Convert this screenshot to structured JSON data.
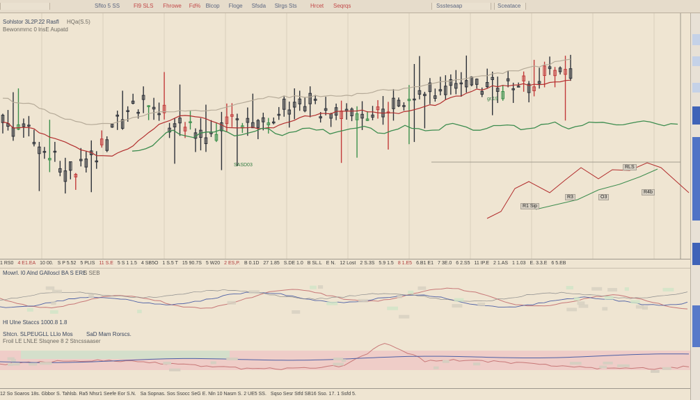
{
  "toolbar": {
    "items": [
      {
        "label": "Sh̃to 5 SS",
        "color": "#5b6680"
      },
      {
        "label": "Fl9 SLS",
        "color": "#c24848"
      },
      {
        "label": "Fhrowe",
        "color": "#c24848"
      },
      {
        "label": "Fd%",
        "color": "#c24848"
      },
      {
        "label": "Blcop",
        "color": "#5b6680"
      },
      {
        "label": "Floge",
        "color": "#5b6680"
      },
      {
        "label": "Sfsda",
        "color": "#5b6680"
      },
      {
        "label": "Slrgs Sts",
        "color": "#5b6680"
      },
      {
        "label": "Hrcet",
        "color": "#c24848"
      },
      {
        "label": "Seqrqs",
        "color": "#c24848"
      }
    ],
    "right_items": [
      {
        "label": "Ssstesaap"
      },
      {
        "label": "Sceatace"
      }
    ]
  },
  "main": {
    "legend_line1": "Sohlstor 3L2P.22 Rasfl",
    "legend_line2": "Bewonmrnc 0 lnsE Aupatd",
    "legend_right": "HQa(S.5)",
    "note_green": "SASD03",
    "note_green2": "gr.19",
    "tags": [
      "R1 Sip",
      "R3",
      "R4b",
      "O3",
      "RLS"
    ]
  },
  "top_axis_labels": [
    {
      "text": "1 RS0",
      "red": false
    },
    {
      "text": "4 E1.EA",
      "red": true
    },
    {
      "text": "10 00.",
      "red": false
    },
    {
      "text": "S P 5.52",
      "red": false
    },
    {
      "text": "5 PLIS",
      "red": false
    },
    {
      "text": "11 S.E",
      "red": true
    },
    {
      "text": "5 S 1 1.5",
      "red": false
    },
    {
      "text": "4 SB5O",
      "red": false
    },
    {
      "text": "1 S.5 T",
      "red": false
    },
    {
      "text": "15 90.7S",
      "red": false
    },
    {
      "text": "5 W20",
      "red": false
    },
    {
      "text": "2 ES,P.",
      "red": true
    },
    {
      "text": "B 0.1D",
      "red": false
    },
    {
      "text": "27 1.85",
      "red": false
    },
    {
      "text": "S.DE 1.0",
      "red": false
    },
    {
      "text": "B SL.L",
      "red": false
    },
    {
      "text": "E N.",
      "red": false
    },
    {
      "text": "12 Lost",
      "red": false
    },
    {
      "text": "2 S.3S",
      "red": false
    },
    {
      "text": "5.9 1.5",
      "red": false
    },
    {
      "text": "8 1.E5",
      "red": true
    },
    {
      "text": "6.B1 E1",
      "red": false
    },
    {
      "text": "7 3E.0",
      "red": false
    },
    {
      "text": "6 2.S5",
      "red": false
    },
    {
      "text": "11 IP.E",
      "red": false
    },
    {
      "text": "2 1.AS",
      "red": false
    },
    {
      "text": "1 1.03",
      "red": false
    },
    {
      "text": "E. 3.3.E",
      "red": false
    },
    {
      "text": "6 5.EB",
      "red": false
    }
  ],
  "osc1": {
    "legend": "Mowrl. I0 Alnd GAlloscl BA S ERE",
    "legend_tag": "S SEB",
    "legend_tag2": "Hl Ulne Staccs 1000.8 1.8"
  },
  "osc2": {
    "legend_line1": "Shtcn. SLPEUGLL  LLlo Mos",
    "legend_right": "SaD Mam Rorscs.",
    "legend_line2": "Froil LE LNLE Slsqnee 8 2 Stncssaaser"
  },
  "bottom_axis_labels": [
    {
      "text": "12 So Soaros 18s. Gbbor S. Tahlsb. Ra5 Nhsr1 Seefe Eor S.N."
    },
    {
      "text": "Sa Sopnas. Sos Ssocc SeG E. Nln 10 Nasm S. 2 UE5 SS."
    },
    {
      "text": "Sqso Sesr Stfd SB16 Sso. 17. 1 Ssfd 5."
    }
  ],
  "colors": {
    "background": "#efe5d2",
    "candle": "#2c3038",
    "candle_accent_green": "#3a8f4a",
    "candle_accent_red": "#c23a3a",
    "ma_red": "#b22d2d",
    "ma_green": "#3c8c4e",
    "ma_gray": "#b5aa98",
    "osc_red": "#c77777",
    "osc_blue": "#4c5fa5",
    "band_pink": "#f0c3c3",
    "band_green": "#cde4cc",
    "grid": "#d9cfbc",
    "right_bar_blue": "#3f63b8"
  },
  "chart_data": {
    "type": "line",
    "series": [],
    "candles_count": 110,
    "price_trend": [
      0.6,
      0.52,
      0.35,
      0.48,
      0.72,
      0.62,
      0.55,
      0.58,
      0.63,
      0.7,
      0.64,
      0.66,
      0.69,
      0.74,
      0.81,
      0.78,
      0.8,
      0.86
    ],
    "grid": true
  }
}
